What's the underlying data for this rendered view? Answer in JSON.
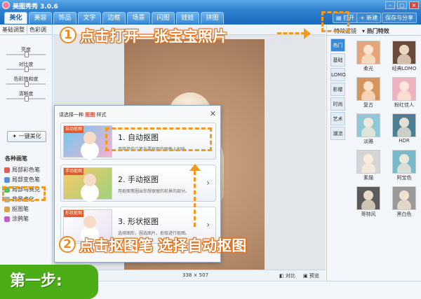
{
  "app": {
    "title": "美图秀秀 3.0.6",
    "window_buttons": [
      "–",
      "□",
      "×"
    ]
  },
  "tabs": [
    "美化",
    "美容",
    "饰品",
    "文字",
    "边框",
    "场景",
    "闪图",
    "娃娃",
    "拼图"
  ],
  "toolbar": {
    "open_label": "打开",
    "new_label": "新建",
    "save_label": "保存与分享"
  },
  "left": {
    "subtabs": [
      "基础调整",
      "色彩调"
    ],
    "sliders": [
      {
        "label": "亮度",
        "value": 0.5
      },
      {
        "label": "对比度",
        "value": 0.5
      },
      {
        "label": "色彩饱和度",
        "value": 0.5
      },
      {
        "label": "清晰度",
        "value": 0.5
      }
    ],
    "one_click_label": "一键美化",
    "brush_title": "各种画笔",
    "brushes": [
      "局部彩色笔",
      "局部变色笔",
      "局部马赛克",
      "背景虚化",
      "抠图笔",
      "涂鸦笔"
    ]
  },
  "canvas": {
    "dimensions": "338 × 507",
    "compare_label": "对比",
    "preview_label": "预览"
  },
  "right": {
    "head_tab": "特效滤镜",
    "head_title": "热门特效",
    "categories": [
      "热门",
      "基础",
      "LOMO",
      "影楼",
      "时尚",
      "艺术",
      "潮流"
    ],
    "effects": [
      {
        "label": "柔光",
        "color": "#e8a47b"
      },
      {
        "label": "经典LOMO",
        "color": "#6a4a3a"
      },
      {
        "label": "复古",
        "color": "#d7955e"
      },
      {
        "label": "粉红佳人",
        "color": "#f0b1c1"
      },
      {
        "label": "淡雅",
        "color": "#8fc9d8"
      },
      {
        "label": "HDR",
        "color": "#4d7f94"
      },
      {
        "label": "素描",
        "color": "#d5d5d5"
      },
      {
        "label": "阿宝色",
        "color": "#7ab9c9"
      },
      {
        "label": "哥特风",
        "color": "#5a5a5a"
      },
      {
        "label": "黑白色",
        "color": "#9a9a9a"
      }
    ]
  },
  "dialog": {
    "title_prefix": "请选择一种",
    "title_highlight": "抠图",
    "title_suffix": "样式",
    "options": [
      {
        "badge": "自动抠图",
        "name": "1. 自动抠图",
        "desc": "用简单的几笔在要抠取的图像上划线。"
      },
      {
        "badge": "手动抠图",
        "name": "2. 手动抠图",
        "desc": "用抠图笔圈出你想保留的前景的部分。"
      },
      {
        "badge": "形状抠图",
        "name": "3. 形状抠图",
        "desc": "选择图形，圈选图片，抠取进行抠图。"
      }
    ]
  },
  "annotations": {
    "step1_num": "1",
    "step1_text": "点击打开一张宝宝照片",
    "step2_num": "2",
    "step2_text": "点击抠图笔 选择自动抠图",
    "step_badge": "第一步:"
  },
  "colors": {
    "accent": "#f39a1e",
    "title_blue": "#2f7fcf",
    "step_green": "#4cae17"
  }
}
